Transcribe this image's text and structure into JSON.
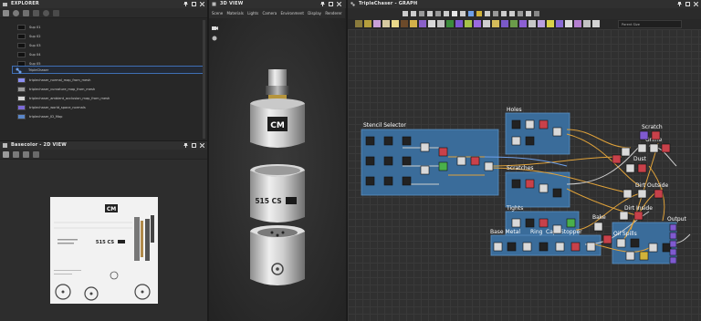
{
  "explorer": {
    "title": "EXPLORER",
    "items": [
      {
        "label": "Sup 01"
      },
      {
        "label": "Sup 02"
      },
      {
        "label": "Sup 03"
      },
      {
        "label": "Sup 04"
      },
      {
        "label": "Sup 05"
      },
      {
        "label": "TripleChaser"
      },
      {
        "label": "triplechaser_normal_map_from_mesh"
      },
      {
        "label": "triplechaser_curvature_map_from_mesh"
      },
      {
        "label": "triplechaser_ambient_occlusion_map_from_mesh"
      },
      {
        "label": "triplechaser_world_space_normals"
      },
      {
        "label": "triplechaser_ID_Map"
      }
    ]
  },
  "view2d": {
    "title": "Basecolor - 2D VIEW",
    "texture_texts": [
      "CM",
      "515 CS"
    ]
  },
  "view3d": {
    "title": "3D VIEW",
    "menu": [
      "Scene",
      "Materials",
      "Lights",
      "Camera",
      "Environment",
      "Display",
      "Renderer"
    ],
    "labels": [
      "CM",
      "515 CS"
    ]
  },
  "graph": {
    "title": "TripleChaser - GRAPH",
    "search_placeholder": "Parent Size",
    "frames": [
      {
        "label": "Stencil Selector"
      },
      {
        "label": "Holes"
      },
      {
        "label": "Scratches"
      },
      {
        "label": "Tights"
      }
    ],
    "labels": [
      "Scratch",
      "Grime",
      "Dust",
      "Dirt Outside",
      "Dirt Inside",
      "Bake",
      "Oil Spills",
      "Output",
      "Base Metal",
      "Ring",
      "Cap",
      "Stopper"
    ]
  },
  "colors": {
    "accent": "#3f6fb5",
    "frame": "#3a6c9a",
    "link": "#e0a23a"
  }
}
